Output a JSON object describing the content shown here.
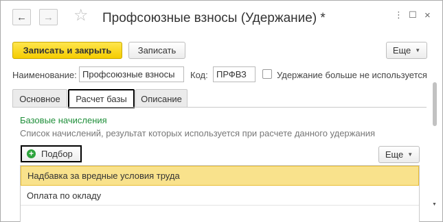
{
  "header": {
    "back_icon": "←",
    "forward_icon": "→",
    "star_icon": "☆",
    "title": "Профсоюзные взносы (Удержание) *",
    "menu_icon": "⋮",
    "maximize_icon": "☐",
    "close_icon": "×"
  },
  "toolbar": {
    "save_close_label": "Записать и закрыть",
    "save_label": "Записать",
    "more_label": "Еще",
    "caret": "▼"
  },
  "form": {
    "name_label": "Наименование:",
    "name_value": "Профсоюзные взносы",
    "code_label": "Код:",
    "code_value": "ПРФВЗ",
    "unused_label": "Удержание больше не используется"
  },
  "tabs": [
    {
      "label": "Основное"
    },
    {
      "label": "Расчет базы"
    },
    {
      "label": "Описание"
    }
  ],
  "base_section": {
    "title": "Базовые начисления",
    "description": "Список начислений, результат которых используется при расчете данного удержания",
    "pick_label": "Подбор",
    "plus_icon": "+",
    "more_label": "Еще",
    "caret": "▼",
    "rows": [
      {
        "label": "Надбавка за вредные условия труда"
      },
      {
        "label": "Оплата по окладу"
      }
    ]
  },
  "colors": {
    "primary_button": "#f5cc00",
    "selected_row": "#f9e28c",
    "section_title": "#1f8f3a",
    "plus_icon": "#2ea43d"
  }
}
